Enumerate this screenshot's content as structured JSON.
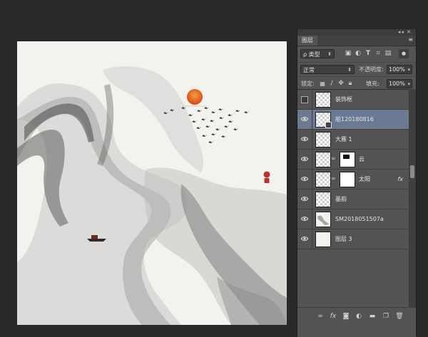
{
  "panel": {
    "title": "图层",
    "grip_buttons": "◂◂ ✕",
    "menu_icon": "panel-menu-icon"
  },
  "filter": {
    "kind_label": "ρ 类型",
    "icons": [
      "image-filter-icon",
      "adjustment-filter-icon",
      "text-filter-icon",
      "shape-filter-icon",
      "smart-object-filter-icon"
    ]
  },
  "blend": {
    "mode": "正常",
    "opacity_label": "不透明度:",
    "opacity_value": "100%"
  },
  "lock": {
    "label": "锁定:",
    "fill_label": "填充:",
    "fill_value": "100%"
  },
  "layers": [
    {
      "name": "装饰框",
      "visible": false,
      "thumb": "transparent",
      "mask": false,
      "fx": false,
      "selected": false
    },
    {
      "name": "船120180816",
      "visible": true,
      "thumb": "transparent",
      "mask": false,
      "fx": false,
      "selected": true
    },
    {
      "name": "大雁 1",
      "visible": true,
      "thumb": "transparent",
      "mask": false,
      "fx": false,
      "selected": false
    },
    {
      "name": "云",
      "visible": true,
      "thumb": "transparent",
      "mask": true,
      "fx": false,
      "selected": false
    },
    {
      "name": "太阳",
      "visible": true,
      "thumb": "transparent",
      "mask": true,
      "fx": true,
      "fx_label": "fx",
      "selected": false
    },
    {
      "name": "墨韵",
      "visible": true,
      "thumb": "transparent",
      "mask": false,
      "fx": false,
      "selected": false
    },
    {
      "name": "SM2018051507a",
      "visible": true,
      "thumb": "sketch",
      "mask": false,
      "fx": false,
      "selected": false
    },
    {
      "name": "图层 3",
      "visible": true,
      "thumb": "light",
      "mask": false,
      "fx": false,
      "selected": false
    }
  ],
  "footer_icons": [
    "link-layers-icon",
    "add-style-icon",
    "add-mask-icon",
    "new-adjustment-icon",
    "new-group-icon",
    "new-layer-icon",
    "delete-layer-icon"
  ],
  "colors": {
    "selected_row": "#6b7a92",
    "panel_bg": "#535353",
    "sun": "#e2571c",
    "seal": "#c0302a"
  }
}
